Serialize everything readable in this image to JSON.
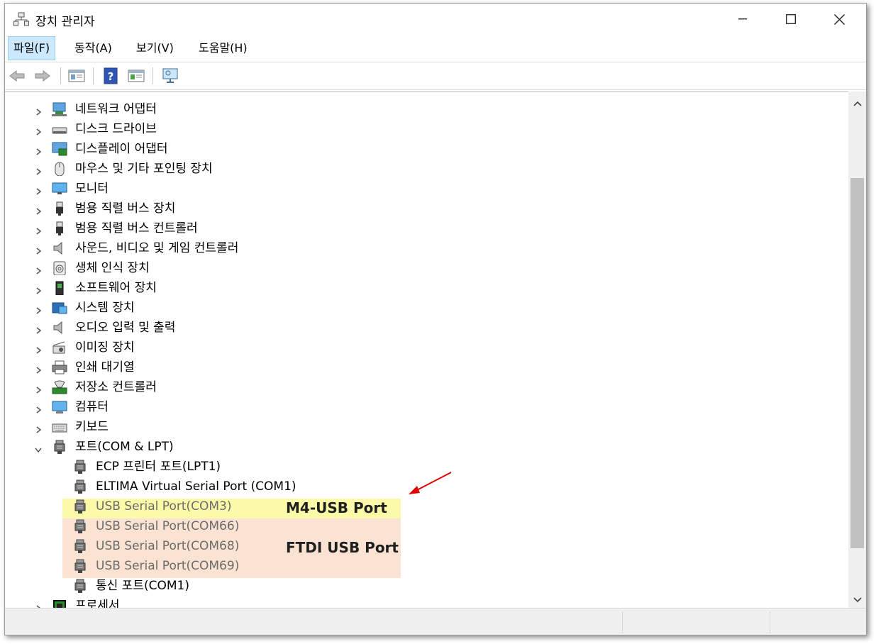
{
  "window": {
    "title": "장치 관리자"
  },
  "menu": [
    {
      "label": "파일(F)"
    },
    {
      "label": "동작(A)"
    },
    {
      "label": "보기(V)"
    },
    {
      "label": "도움말(H)"
    }
  ],
  "toolbar": [
    "back-arrow-icon",
    "forward-arrow-icon",
    "properties-icon",
    "help-icon",
    "view-pane-icon",
    "monitor-scan-icon"
  ],
  "tree": {
    "categories": [
      {
        "label": "네트워크 어댑터",
        "icon": "network-adapter-icon"
      },
      {
        "label": "디스크 드라이브",
        "icon": "disk-drive-icon"
      },
      {
        "label": "디스플레이 어댑터",
        "icon": "display-adapter-icon"
      },
      {
        "label": "마우스 및 기타 포인팅 장치",
        "icon": "mouse-icon"
      },
      {
        "label": "모니터",
        "icon": "monitor-icon"
      },
      {
        "label": "범용 직렬 버스 장치",
        "icon": "usb-icon"
      },
      {
        "label": "범용 직렬 버스 컨트롤러",
        "icon": "usb-controller-icon"
      },
      {
        "label": "사운드, 비디오 및 게임 컨트롤러",
        "icon": "speaker-icon"
      },
      {
        "label": "생체 인식 장치",
        "icon": "fingerprint-icon"
      },
      {
        "label": "소프트웨어 장치",
        "icon": "software-device-icon"
      },
      {
        "label": "시스템 장치",
        "icon": "system-device-icon"
      },
      {
        "label": "오디오 입력 및 출력",
        "icon": "audio-io-icon"
      },
      {
        "label": "이미징 장치",
        "icon": "camera-icon"
      },
      {
        "label": "인쇄 대기열",
        "icon": "printer-icon"
      },
      {
        "label": "저장소 컨트롤러",
        "icon": "storage-controller-icon"
      },
      {
        "label": "컴퓨터",
        "icon": "computer-icon"
      },
      {
        "label": "키보드",
        "icon": "keyboard-icon"
      }
    ],
    "ports": {
      "label": "포트(COM & LPT)",
      "children": [
        {
          "label": "ECP 프린터 포트(LPT1)"
        },
        {
          "label": "ELTIMA Virtual Serial Port (COM1)"
        },
        {
          "label": "USB Serial Port(COM3)"
        },
        {
          "label": "USB Serial Port(COM66)"
        },
        {
          "label": "USB Serial Port(COM68)"
        },
        {
          "label": "USB Serial Port(COM69)"
        },
        {
          "label": "통신 포트(COM1)"
        }
      ]
    },
    "last": {
      "label": "프로세서",
      "icon": "processor-icon"
    }
  },
  "annotations": {
    "m4": "M4-USB Port",
    "ftdi": "FTDI USB Port",
    "colors": {
      "yellow": "#fafaa8",
      "peach": "#fbe3d3",
      "arrow": "#e00000"
    }
  }
}
